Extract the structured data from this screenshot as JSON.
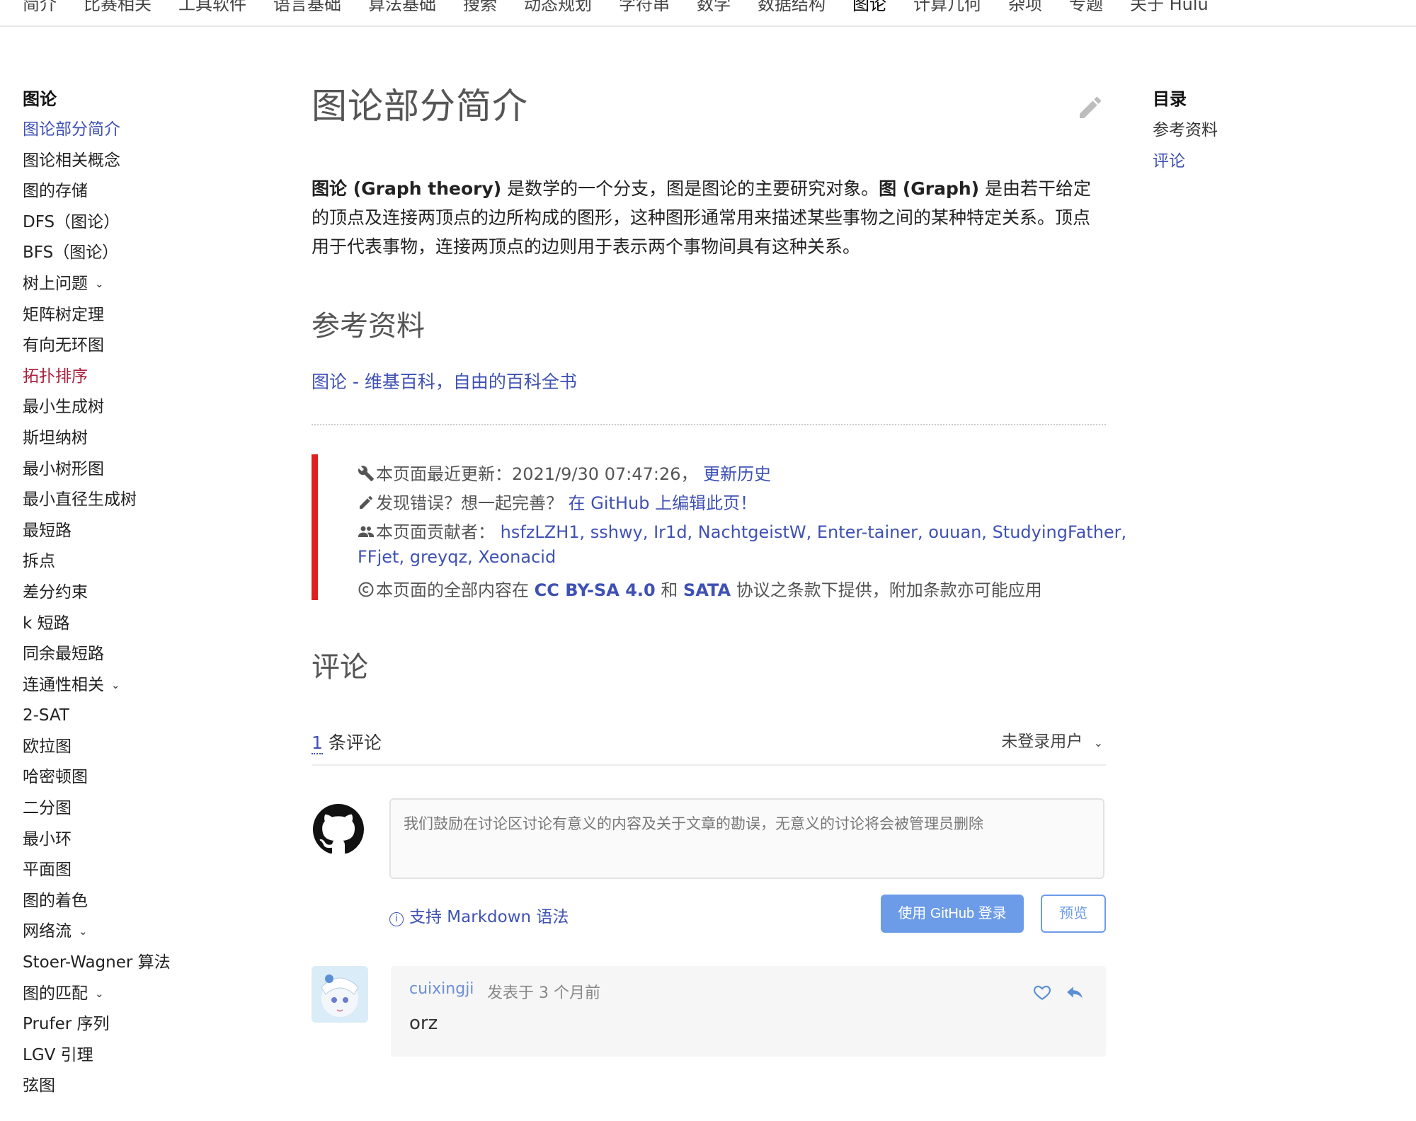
{
  "nav": {
    "tabs": [
      "简介",
      "比赛相关",
      "工具软件",
      "语言基础",
      "算法基础",
      "搜索",
      "动态规划",
      "字符串",
      "数学",
      "数据结构",
      "图论",
      "计算几何",
      "杂项",
      "专题",
      "关于 Hulu"
    ],
    "active": "图论"
  },
  "sidebar": {
    "section_title": "图论",
    "items": [
      {
        "label": "图论部分简介",
        "state": "current"
      },
      {
        "label": "图论相关概念"
      },
      {
        "label": "图的存储"
      },
      {
        "label": "DFS（图论）"
      },
      {
        "label": "BFS（图论）"
      },
      {
        "label": "树上问题",
        "expandable": true
      },
      {
        "label": "矩阵树定理"
      },
      {
        "label": "有向无环图"
      },
      {
        "label": "拓扑排序",
        "state": "visited"
      },
      {
        "label": "最小生成树"
      },
      {
        "label": "斯坦纳树"
      },
      {
        "label": "最小树形图"
      },
      {
        "label": "最小直径生成树"
      },
      {
        "label": "最短路"
      },
      {
        "label": "拆点"
      },
      {
        "label": "差分约束"
      },
      {
        "label": "k 短路"
      },
      {
        "label": "同余最短路"
      },
      {
        "label": "连通性相关",
        "expandable": true
      },
      {
        "label": "2-SAT"
      },
      {
        "label": "欧拉图"
      },
      {
        "label": "哈密顿图"
      },
      {
        "label": "二分图"
      },
      {
        "label": "最小环"
      },
      {
        "label": "平面图"
      },
      {
        "label": "图的着色"
      },
      {
        "label": "网络流",
        "expandable": true
      },
      {
        "label": "Stoer-Wagner 算法"
      },
      {
        "label": "图的匹配",
        "expandable": true
      },
      {
        "label": "Prufer 序列"
      },
      {
        "label": "LGV 引理"
      },
      {
        "label": "弦图"
      }
    ]
  },
  "main": {
    "title": "图论部分简介",
    "intro": {
      "b1": "图论 (Graph theory)",
      "t1": " 是数学的一个分支，图是图论的主要研究对象。",
      "b2": "图 (Graph)",
      "t2": " 是由若干给定的顶点及连接两顶点的边所构成的图形，这种图形通常用来描述某些事物之间的某种特定关系。顶点用于代表事物，连接两顶点的边则用于表示两个事物间具有这种关系。"
    },
    "references_heading": "参考资料",
    "reference_link": "图论 - 维基百科，自由的百科全书",
    "meta": {
      "updated_label": "本页面最近更新：",
      "updated_time": "2021/9/30 07:47:26，",
      "history_link": "更新历史",
      "error_label": "发现错误？想一起完善？",
      "github_edit_link": "在 GitHub 上编辑此页！",
      "contributors_label": "本页面贡献者：",
      "contributors_line1": "hsfzLZH1, sshwy, Ir1d, NachtgeistW, Enter-tainer, ouuan, StudyingFather,",
      "contributors_line2": "FFjet, greyqz, Xeonacid",
      "license_pre": "本页面的全部内容在",
      "license_cc": "CC BY-SA 4.0",
      "license_and": "和",
      "license_sata": "SATA",
      "license_post": "协议之条款下提供，附加条款亦可能应用"
    },
    "comments_heading": "评论",
    "comments": {
      "count": "1",
      "count_suffix": "条评论",
      "user_menu": "未登录用户",
      "placeholder": "我们鼓励在讨论区讨论有意义的内容及关于文章的勘误，无意义的讨论将会被管理员删除",
      "markdown_hint": "支持 Markdown 语法",
      "login_button": "使用 GitHub 登录",
      "preview_button": "预览",
      "items": [
        {
          "author": "cuixingji",
          "posted": "发表于 3 个月前",
          "body": "orz"
        }
      ]
    }
  },
  "toc": {
    "title": "目录",
    "items": [
      {
        "label": "参考资料"
      },
      {
        "label": "评论",
        "state": "active"
      }
    ]
  },
  "colors": {
    "link": "#3f51b5",
    "visited": "#a7213c",
    "accent_bar": "#e02020",
    "button": "#6c9ce8"
  }
}
